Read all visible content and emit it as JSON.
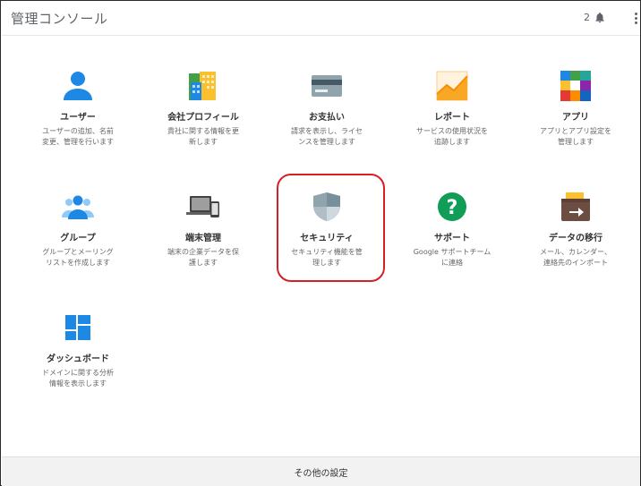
{
  "header": {
    "title": "管理コンソール",
    "notification_count": "2",
    "notification_icon": "bell-icon",
    "menu_icon": "more-vert-icon"
  },
  "tiles": [
    {
      "name": "ユーザー",
      "desc": "ユーザーの追加、名前\n変更、管理を行います",
      "icon": "person-icon"
    },
    {
      "name": "会社プロフィール",
      "desc": "貴社に関する情報を更\n新します",
      "icon": "company-building-icon"
    },
    {
      "name": "お支払い",
      "desc": "請求を表示し、ライセ\nンスを管理します",
      "icon": "credit-card-icon"
    },
    {
      "name": "レポート",
      "desc": "サービスの使用状況を\n追跡します",
      "icon": "report-chart-icon"
    },
    {
      "name": "アプリ",
      "desc": "アプリとアプリ設定を\n管理します",
      "icon": "apps-grid-icon"
    },
    {
      "name": "グループ",
      "desc": "グループとメーリング\nリストを作成します",
      "icon": "group-icon"
    },
    {
      "name": "端末管理",
      "desc": "端末の企業データを保\n護します",
      "icon": "devices-icon"
    },
    {
      "name": "セキュリティ",
      "desc": "セキュリティ機能を管\n理します",
      "icon": "shield-icon"
    },
    {
      "name": "サポート",
      "desc": "Google サポートチーム\nに連絡",
      "icon": "help-question-icon"
    },
    {
      "name": "データの移行",
      "desc": "メール、カレンダー、\n連絡先のインポート",
      "icon": "data-migration-icon"
    },
    {
      "name": "ダッシュボード",
      "desc": "ドメインに関する分析\n情報を表示します",
      "icon": "dashboard-icon"
    }
  ],
  "footer": {
    "label": "その他の設定"
  },
  "colors": {
    "highlight": "#d71f26",
    "user_blue": "#1e88e5"
  }
}
